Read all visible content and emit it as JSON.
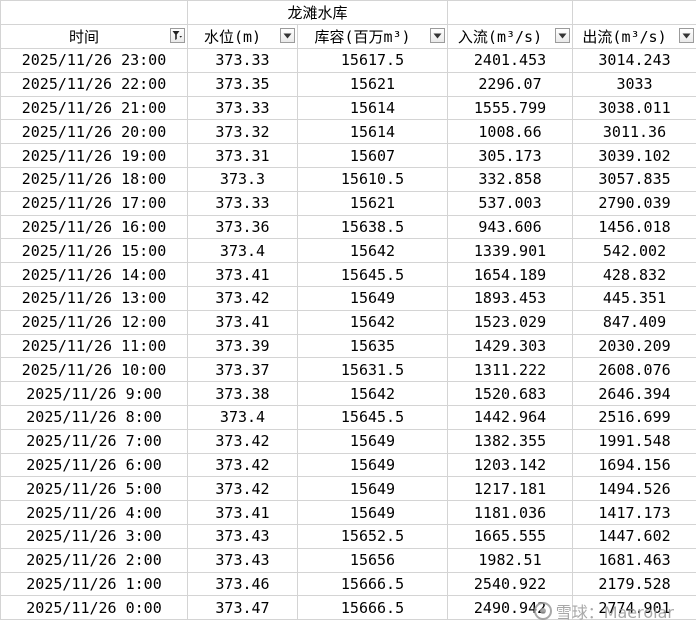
{
  "sheet": {
    "title": "龙滩水库",
    "headers": {
      "time": "时间",
      "level": "水位(m)",
      "storage": "库容(百万m³)",
      "inflow": "入流(m³/s)",
      "outflow": "出流(m³/s)"
    },
    "rows": [
      {
        "time": "2025/11/26 23:00",
        "level": "373.33",
        "storage": "15617.5",
        "inflow": "2401.453",
        "outflow": "3014.243"
      },
      {
        "time": "2025/11/26 22:00",
        "level": "373.35",
        "storage": "15621",
        "inflow": "2296.07",
        "outflow": "3033"
      },
      {
        "time": "2025/11/26 21:00",
        "level": "373.33",
        "storage": "15614",
        "inflow": "1555.799",
        "outflow": "3038.011"
      },
      {
        "time": "2025/11/26 20:00",
        "level": "373.32",
        "storage": "15614",
        "inflow": "1008.66",
        "outflow": "3011.36"
      },
      {
        "time": "2025/11/26 19:00",
        "level": "373.31",
        "storage": "15607",
        "inflow": "305.173",
        "outflow": "3039.102"
      },
      {
        "time": "2025/11/26 18:00",
        "level": "373.3",
        "storage": "15610.5",
        "inflow": "332.858",
        "outflow": "3057.835"
      },
      {
        "time": "2025/11/26 17:00",
        "level": "373.33",
        "storage": "15621",
        "inflow": "537.003",
        "outflow": "2790.039"
      },
      {
        "time": "2025/11/26 16:00",
        "level": "373.36",
        "storage": "15638.5",
        "inflow": "943.606",
        "outflow": "1456.018"
      },
      {
        "time": "2025/11/26 15:00",
        "level": "373.4",
        "storage": "15642",
        "inflow": "1339.901",
        "outflow": "542.002"
      },
      {
        "time": "2025/11/26 14:00",
        "level": "373.41",
        "storage": "15645.5",
        "inflow": "1654.189",
        "outflow": "428.832"
      },
      {
        "time": "2025/11/26 13:00",
        "level": "373.42",
        "storage": "15649",
        "inflow": "1893.453",
        "outflow": "445.351"
      },
      {
        "time": "2025/11/26 12:00",
        "level": "373.41",
        "storage": "15642",
        "inflow": "1523.029",
        "outflow": "847.409"
      },
      {
        "time": "2025/11/26 11:00",
        "level": "373.39",
        "storage": "15635",
        "inflow": "1429.303",
        "outflow": "2030.209"
      },
      {
        "time": "2025/11/26 10:00",
        "level": "373.37",
        "storage": "15631.5",
        "inflow": "1311.222",
        "outflow": "2608.076"
      },
      {
        "time": "2025/11/26 9:00",
        "level": "373.38",
        "storage": "15642",
        "inflow": "1520.683",
        "outflow": "2646.394"
      },
      {
        "time": "2025/11/26 8:00",
        "level": "373.4",
        "storage": "15645.5",
        "inflow": "1442.964",
        "outflow": "2516.699"
      },
      {
        "time": "2025/11/26 7:00",
        "level": "373.42",
        "storage": "15649",
        "inflow": "1382.355",
        "outflow": "1991.548"
      },
      {
        "time": "2025/11/26 6:00",
        "level": "373.42",
        "storage": "15649",
        "inflow": "1203.142",
        "outflow": "1694.156"
      },
      {
        "time": "2025/11/26 5:00",
        "level": "373.42",
        "storage": "15649",
        "inflow": "1217.181",
        "outflow": "1494.526"
      },
      {
        "time": "2025/11/26 4:00",
        "level": "373.41",
        "storage": "15649",
        "inflow": "1181.036",
        "outflow": "1417.173"
      },
      {
        "time": "2025/11/26 3:00",
        "level": "373.43",
        "storage": "15652.5",
        "inflow": "1665.555",
        "outflow": "1447.602"
      },
      {
        "time": "2025/11/26 2:00",
        "level": "373.43",
        "storage": "15656",
        "inflow": "1982.51",
        "outflow": "1681.463"
      },
      {
        "time": "2025/11/26 1:00",
        "level": "373.46",
        "storage": "15666.5",
        "inflow": "2540.922",
        "outflow": "2179.528"
      },
      {
        "time": "2025/11/26 0:00",
        "level": "373.47",
        "storage": "15666.5",
        "inflow": "2490.942",
        "outflow": "2774.901"
      }
    ]
  },
  "watermark": {
    "text": "雪球：Maerolar",
    "icon": "snowball-logo-icon"
  },
  "colors": {
    "grid": "#d4d4d4",
    "text": "#000000",
    "watermark": "#9a9a9a"
  }
}
